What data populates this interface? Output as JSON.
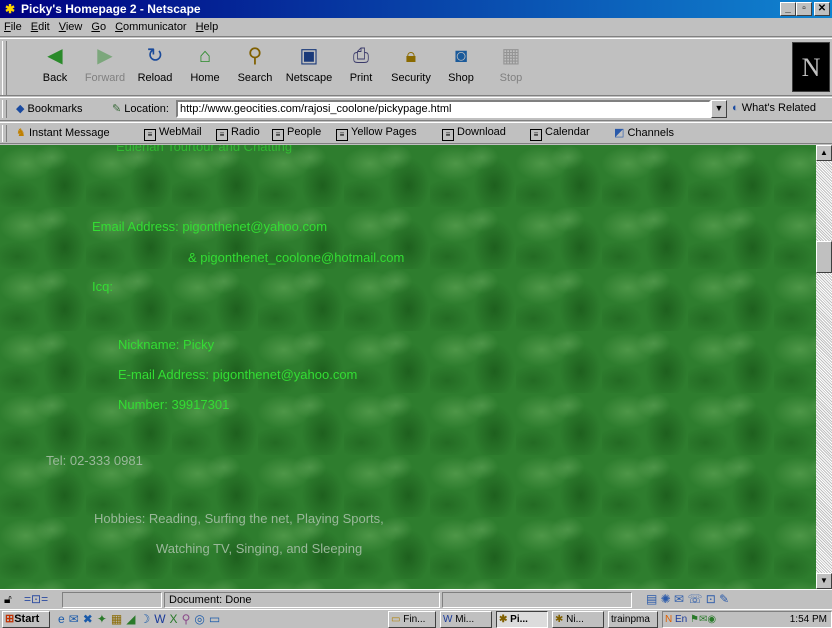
{
  "window": {
    "title": "Picky's Homepage 2 - Netscape"
  },
  "menu": [
    {
      "pre": "",
      "u": "F",
      "post": "ile"
    },
    {
      "pre": "",
      "u": "E",
      "post": "dit"
    },
    {
      "pre": "",
      "u": "V",
      "post": "iew"
    },
    {
      "pre": "",
      "u": "G",
      "post": "o"
    },
    {
      "pre": "",
      "u": "C",
      "post": "ommunicator"
    },
    {
      "pre": "",
      "u": "H",
      "post": "elp"
    }
  ],
  "toolbar": {
    "back": "Back",
    "forward": "Forward",
    "reload": "Reload",
    "home": "Home",
    "search": "Search",
    "netscape": "Netscape",
    "print": "Print",
    "security": "Security",
    "shop": "Shop",
    "stop": "Stop"
  },
  "location": {
    "bookmarks_label": "Bookmarks",
    "location_label": "Location:",
    "url": "http://www.geocities.com/rajosi_coolone/pickypage.html",
    "related_label": "What's Related"
  },
  "personal_toolbar": {
    "instant_message": "Instant Message",
    "webmail": "WebMail",
    "radio": "Radio",
    "people": "People",
    "yellow_pages": "Yellow Pages",
    "download": "Download",
    "calendar": "Calendar",
    "channels": "Channels"
  },
  "content": {
    "cut_line": "Eulerian Tourtour and Chatting",
    "email_line": "Email Address: pigonthenet@yahoo.com",
    "email_line2": "& pigonthenet_coolone@hotmail.com",
    "icq_label": "Icq:",
    "nickname": "Nickname: Picky",
    "icq_email": "E-mail Address: pigonthenet@yahoo.com",
    "number": "Number: 39917301",
    "tel": "Tel: 02-333 0981",
    "hobbies": "Hobbies: Reading, Surfing the net, Playing Sports,",
    "hobbies2": "Watching TV, Singing, and Sleeping"
  },
  "status": {
    "text": "Document: Done"
  },
  "taskbar": {
    "start": "Start",
    "tasks": [
      "Fin...",
      "Mi...",
      "Pi...",
      "Ni...",
      "trainpma"
    ],
    "clock": "1:54 PM"
  },
  "colors": {
    "page_text": "#33dd33",
    "page_bg": "#2e7d2e",
    "title_bar": "#000080"
  }
}
